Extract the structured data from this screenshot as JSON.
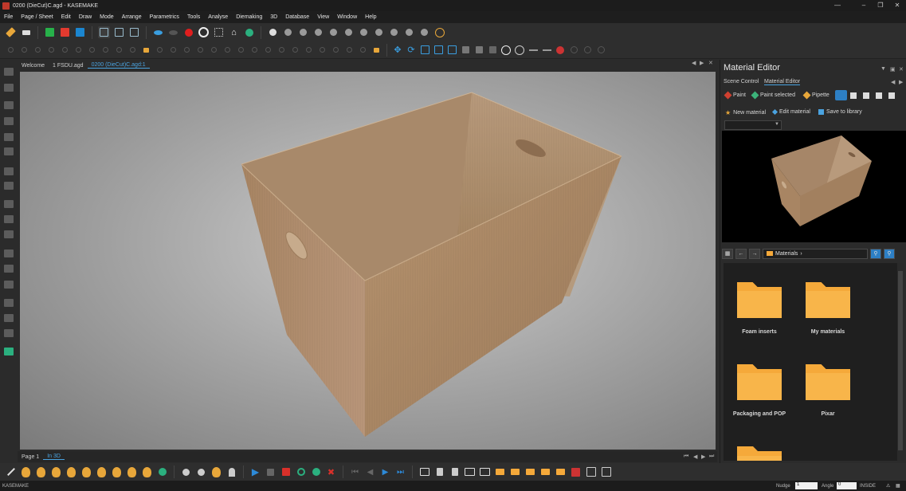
{
  "window": {
    "title": "0200 (DieCut)C.agd - KASEMAKE"
  },
  "menu": [
    "File",
    "Page / Sheet",
    "Edit",
    "Draw",
    "Mode",
    "Arrange",
    "Parametrics",
    "Tools",
    "Analyse",
    "Diemaking",
    "3D",
    "Database",
    "View",
    "Window",
    "Help"
  ],
  "doc_tabs": [
    "Welcome",
    "1 FSDU.agd",
    "0200 (DieCut)C.agd:1"
  ],
  "page_tabs": [
    "Page 1",
    "In 3D"
  ],
  "material_editor": {
    "title": "Material Editor",
    "subtabs": [
      "Scene Control",
      "Material Editor"
    ],
    "paint": "Paint",
    "paint_selected": "Paint selected",
    "pipette": "Pipette",
    "new_material": "New material",
    "edit_material": "Edit material",
    "save_to_library": "Save to library",
    "library_path": "Materials",
    "folders": [
      "Foam inserts",
      "My materials",
      "Packaging and POP",
      "Pixar"
    ]
  },
  "status": {
    "app": "KASEMAKE",
    "nudge_label": "Nudge",
    "nudge_value": "1",
    "angle_label": "Angle",
    "angle_value": "0",
    "mode": "INSIDE"
  },
  "colors": {
    "accent": "#4aa3e0",
    "folder": "#f5a93a",
    "box": "#b69270"
  }
}
